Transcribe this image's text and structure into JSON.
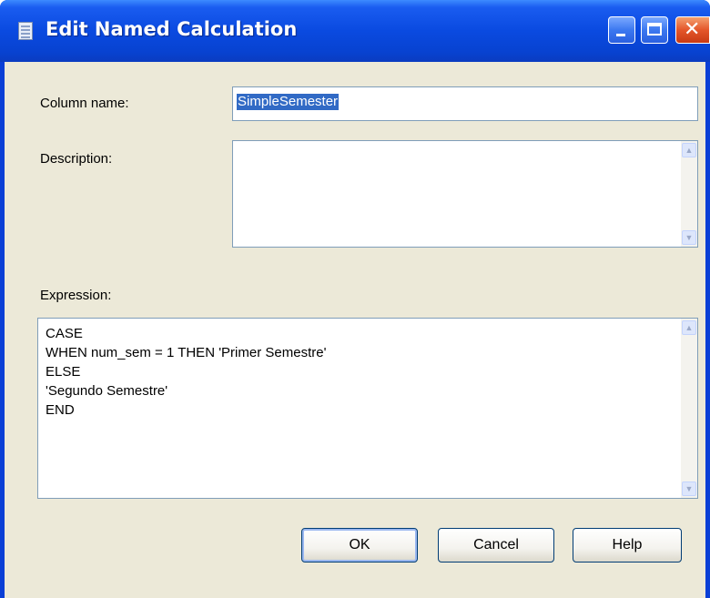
{
  "window": {
    "title": "Edit Named Calculation"
  },
  "form": {
    "column_name_label": "Column name:",
    "column_name_value": "SimpleSemester",
    "description_label": "Description:",
    "description_value": "",
    "expression_label": "Expression:",
    "expression_value": "CASE\nWHEN num_sem = 1 THEN 'Primer Semestre'\nELSE\n'Segundo Semestre'\nEND"
  },
  "buttons": {
    "ok": "OK",
    "cancel": "Cancel",
    "help": "Help"
  },
  "icons": {
    "title": "table-icon",
    "minimize": "minimize-icon",
    "maximize": "maximize-icon",
    "close": "close-icon"
  },
  "colors": {
    "titlebar": "#0a4ae0",
    "close_button": "#e4562a",
    "dialog_face": "#ece9d8",
    "selection": "#316ac5"
  }
}
